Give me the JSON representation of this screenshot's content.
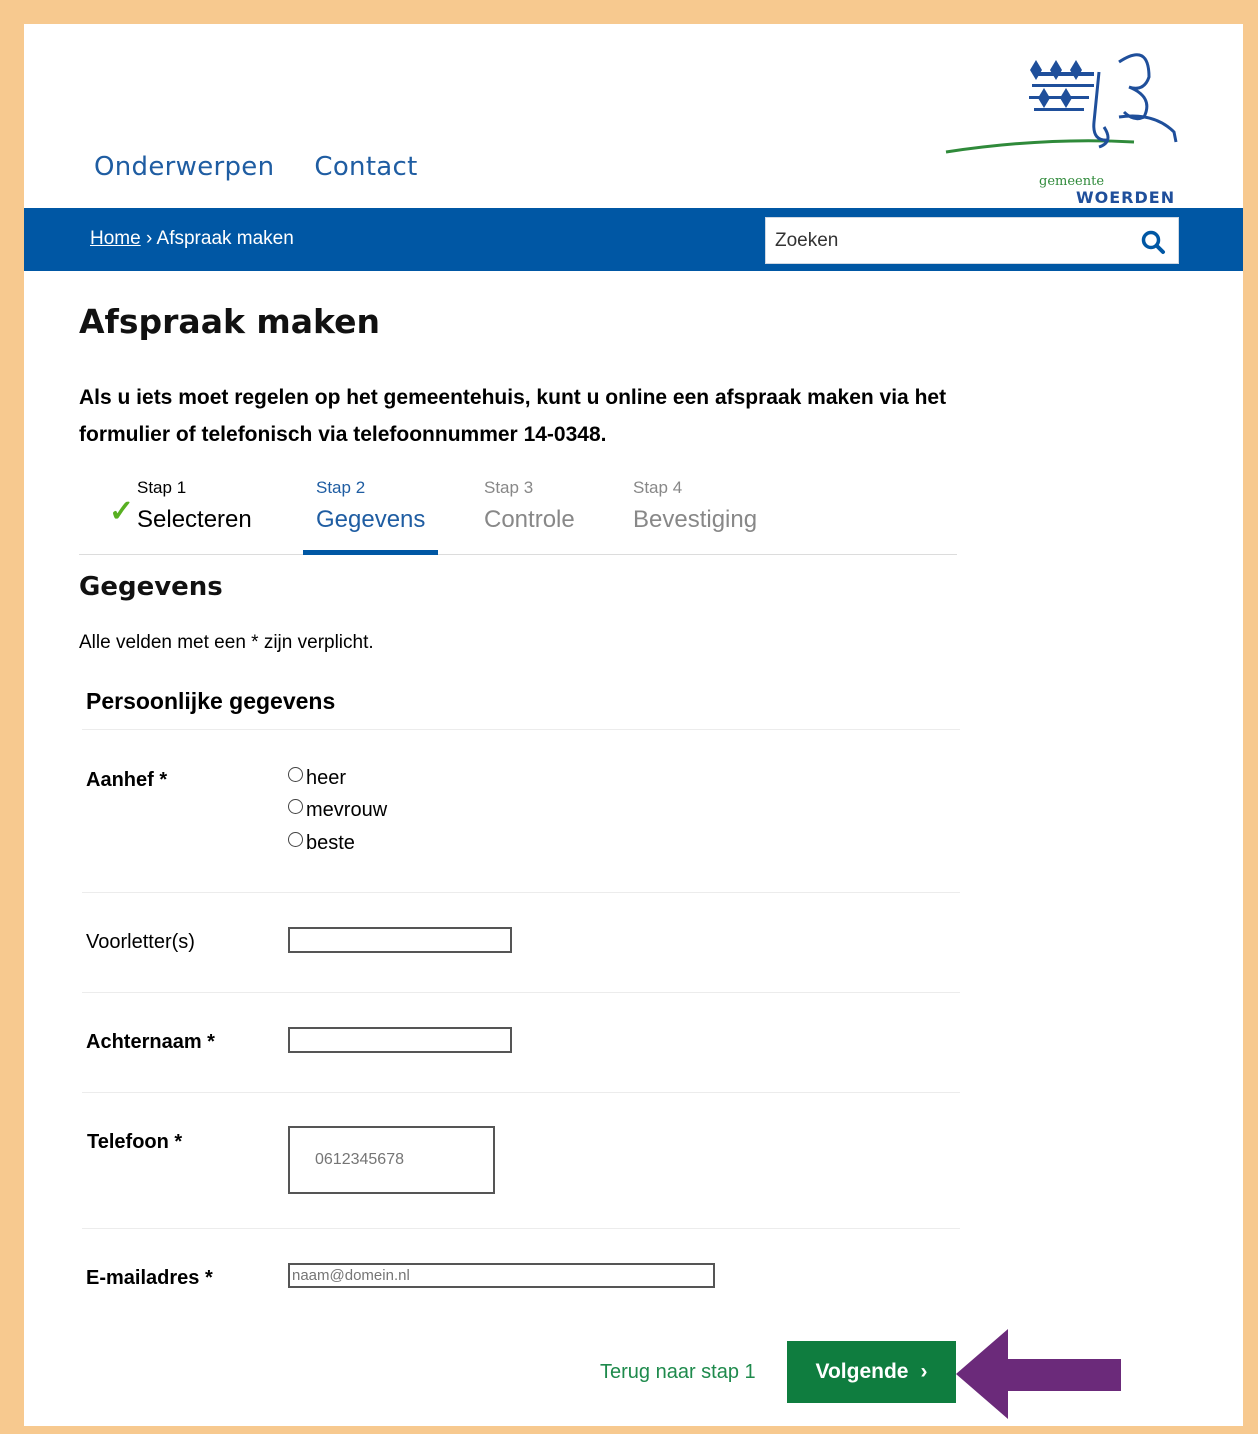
{
  "nav": {
    "item1": "Onderwerpen",
    "item2": "Contact"
  },
  "logo": {
    "line1": "gemeente",
    "line2": "WOERDEN"
  },
  "breadcrumb": {
    "home": "Home",
    "separator": " › ",
    "current": "Afspraak maken"
  },
  "search": {
    "placeholder": "Zoeken"
  },
  "page": {
    "title": "Afspraak maken",
    "intro": "Als u iets moet regelen op het gemeentehuis, kunt u online een afspraak maken via het formulier of telefonisch via telefoonnummer 14-0348."
  },
  "steps": [
    {
      "num": "Stap 1",
      "label": "Selecteren",
      "state": "done"
    },
    {
      "num": "Stap 2",
      "label": "Gegevens",
      "state": "active"
    },
    {
      "num": "Stap 3",
      "label": "Controle",
      "state": "todo"
    },
    {
      "num": "Stap 4",
      "label": "Bevestiging",
      "state": "todo"
    }
  ],
  "form": {
    "heading": "Gegevens",
    "required_note": "Alle velden met een * zijn verplicht.",
    "section": "Persoonlijke gegevens",
    "aanhef_label": "Aanhef *",
    "aanhef_options": [
      "heer",
      "mevrouw",
      "beste"
    ],
    "voorletters_label": "Voorletter(s)",
    "achternaam_label": "Achternaam *",
    "telefoon_label": "Telefoon *",
    "telefoon_placeholder": "0612345678",
    "email_label": "E-mailadres *",
    "email_placeholder": "naam@domein.nl"
  },
  "actions": {
    "back": "Terug naar stap 1",
    "next": "Volgende",
    "next_icon": "›"
  },
  "colors": {
    "brand_blue": "#0057a4",
    "green": "#0f7d3f",
    "frame": "#f7c98f",
    "annotation_arrow": "#6b2a7a"
  }
}
